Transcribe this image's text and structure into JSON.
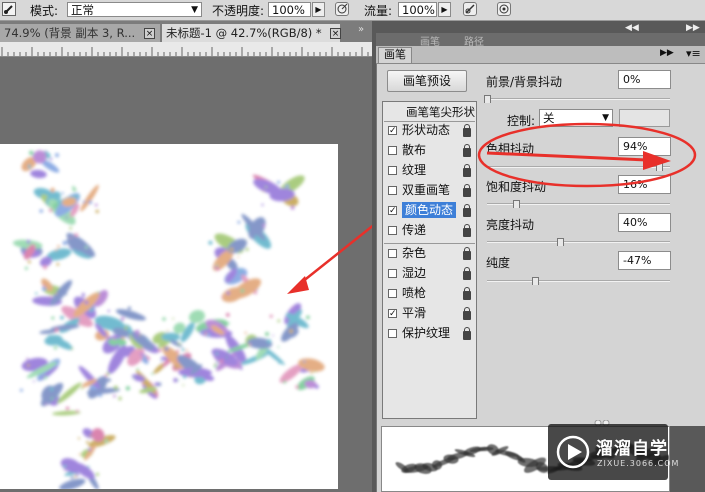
{
  "options_bar": {
    "mode_label": "模式:",
    "mode_value": "正常",
    "opacity_label": "不透明度:",
    "opacity_value": "100%",
    "flow_label": "流量:",
    "flow_value": "100%"
  },
  "doc_tabs": [
    {
      "title": "74.9% (背景 副本 3, R...",
      "active": false
    },
    {
      "title": "未标题-1 @ 42.7%(RGB/8) *",
      "active": true
    }
  ],
  "panel": {
    "tabs": [
      "画笔",
      "画笔",
      "路径"
    ],
    "preset_button": "画笔预设",
    "tip_shape_label": "画笔笔尖形状",
    "items": [
      {
        "label": "形状动态",
        "checked": true,
        "locked": true,
        "selected": false
      },
      {
        "label": "散布",
        "checked": false,
        "locked": true,
        "selected": false
      },
      {
        "label": "纹理",
        "checked": false,
        "locked": true,
        "selected": false
      },
      {
        "label": "双重画笔",
        "checked": false,
        "locked": true,
        "selected": false
      },
      {
        "label": "颜色动态",
        "checked": true,
        "locked": true,
        "selected": true
      },
      {
        "label": "传递",
        "checked": false,
        "locked": true,
        "selected": false
      },
      {
        "label": "杂色",
        "checked": false,
        "locked": true,
        "selected": false
      },
      {
        "label": "湿边",
        "checked": false,
        "locked": true,
        "selected": false
      },
      {
        "label": "喷枪",
        "checked": false,
        "locked": true,
        "selected": false
      },
      {
        "label": "平滑",
        "checked": true,
        "locked": true,
        "selected": false
      },
      {
        "label": "保护纹理",
        "checked": false,
        "locked": true,
        "selected": false
      }
    ],
    "fg_bg_jitter": {
      "label": "前景/背景抖动",
      "value": "0%",
      "level": 0
    },
    "control": {
      "label": "控制:",
      "value": "关"
    },
    "hue_jitter": {
      "label": "色相抖动",
      "value": "94%",
      "level": 0.94
    },
    "saturation_jitter": {
      "label": "饱和度抖动",
      "value": "16%",
      "level": 0.16
    },
    "brightness_jitter": {
      "label": "亮度抖动",
      "value": "40%",
      "level": 0.4
    },
    "purity": {
      "label": "纯度",
      "value": "-47%",
      "level": 0.265
    }
  },
  "watermark": {
    "brand": "溜溜自学",
    "url": "ZIXUE.3066.COM"
  },
  "colors": {
    "annotation_red": "#e8302a",
    "selected_blue": "#3d7fd8"
  }
}
